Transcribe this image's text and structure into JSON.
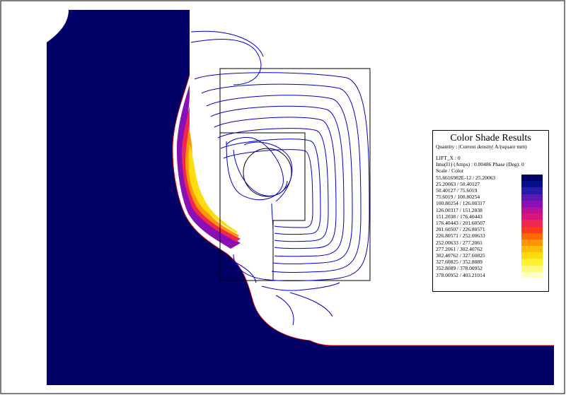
{
  "legend": {
    "title": "Color Shade Results",
    "quantity": "Quantity : |Current density| A/(square mm)",
    "param": "LIFT_X : 0",
    "current": "Imu(I1) (Amps) : 0.00486 Phase (Deg): 0",
    "scale_label": "Scale / Color",
    "ranges": [
      "55.6616982E-12  /  25.20063",
      "25.20063  /  50.40127",
      "50.40127  /  75.6019",
      "75.6019  /  100.80254",
      "100.80254  /  126.00317",
      "126.00317  /  151.2038",
      "151.2038  /  176.40443",
      "176.40443  /  201.60507",
      "201.60507  /  226.80571",
      "226.80571  /  252.00633",
      "252.00633  /  277.2061",
      "277.2061  /  302.40762",
      "302.40762  /  327.60825",
      "327.60825  /  352.8089",
      "352.8089  /  378.00952",
      "378.00952  /  403.21014"
    ],
    "colors": [
      "#000066",
      "#06108a",
      "#2a1aa8",
      "#5a1ab4",
      "#8a0fb4",
      "#b8109c",
      "#d81878",
      "#ee2850",
      "#ff3a1a",
      "#ff6a08",
      "#ff9606",
      "#ffbc08",
      "#ffdc10",
      "#fff030",
      "#fffa80",
      "#ffffc8"
    ]
  },
  "colors": {
    "conductor": "#000066",
    "flux_lines": "#0000cc",
    "outline": "#000000"
  }
}
